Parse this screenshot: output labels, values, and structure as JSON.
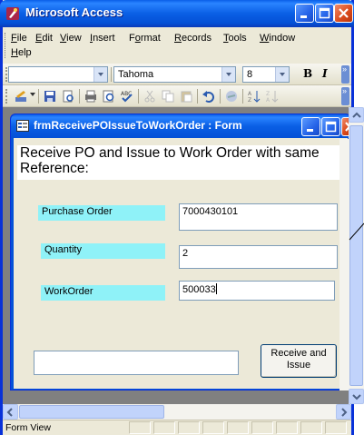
{
  "window": {
    "title": "Microsoft Access"
  },
  "menu": {
    "items": [
      {
        "label": "File",
        "u": "F"
      },
      {
        "label": "Edit",
        "u": "E"
      },
      {
        "label": "View",
        "u": "V"
      },
      {
        "label": "Insert",
        "u": "I"
      },
      {
        "label": "Format",
        "u": "o"
      },
      {
        "label": "Records",
        "u": "R"
      },
      {
        "label": "Tools",
        "u": "T"
      },
      {
        "label": "Window",
        "u": "W"
      },
      {
        "label": "Help",
        "u": "H"
      }
    ]
  },
  "formatting": {
    "object_combo": "",
    "font": "Tahoma",
    "size": "8",
    "bold": "B",
    "italic": "I"
  },
  "form": {
    "title": "frmReceivePOIssueToWorkOrder : Form",
    "heading": "Receive PO and Issue to Work Order with same Reference:",
    "fields": {
      "po_label": "Purchase Order",
      "po_value": "7000430101",
      "qty_label": "Quantity",
      "qty_value": "2",
      "wo_label": "WorkOrder",
      "wo_value": "500033"
    },
    "message_box": "",
    "receive_button": "Receive and Issue"
  },
  "status": {
    "text": "Form View"
  },
  "colors": {
    "title_blue": "#0a5fe5",
    "label_cyan": "#8ff2f8",
    "close_red": "#d9491a"
  }
}
